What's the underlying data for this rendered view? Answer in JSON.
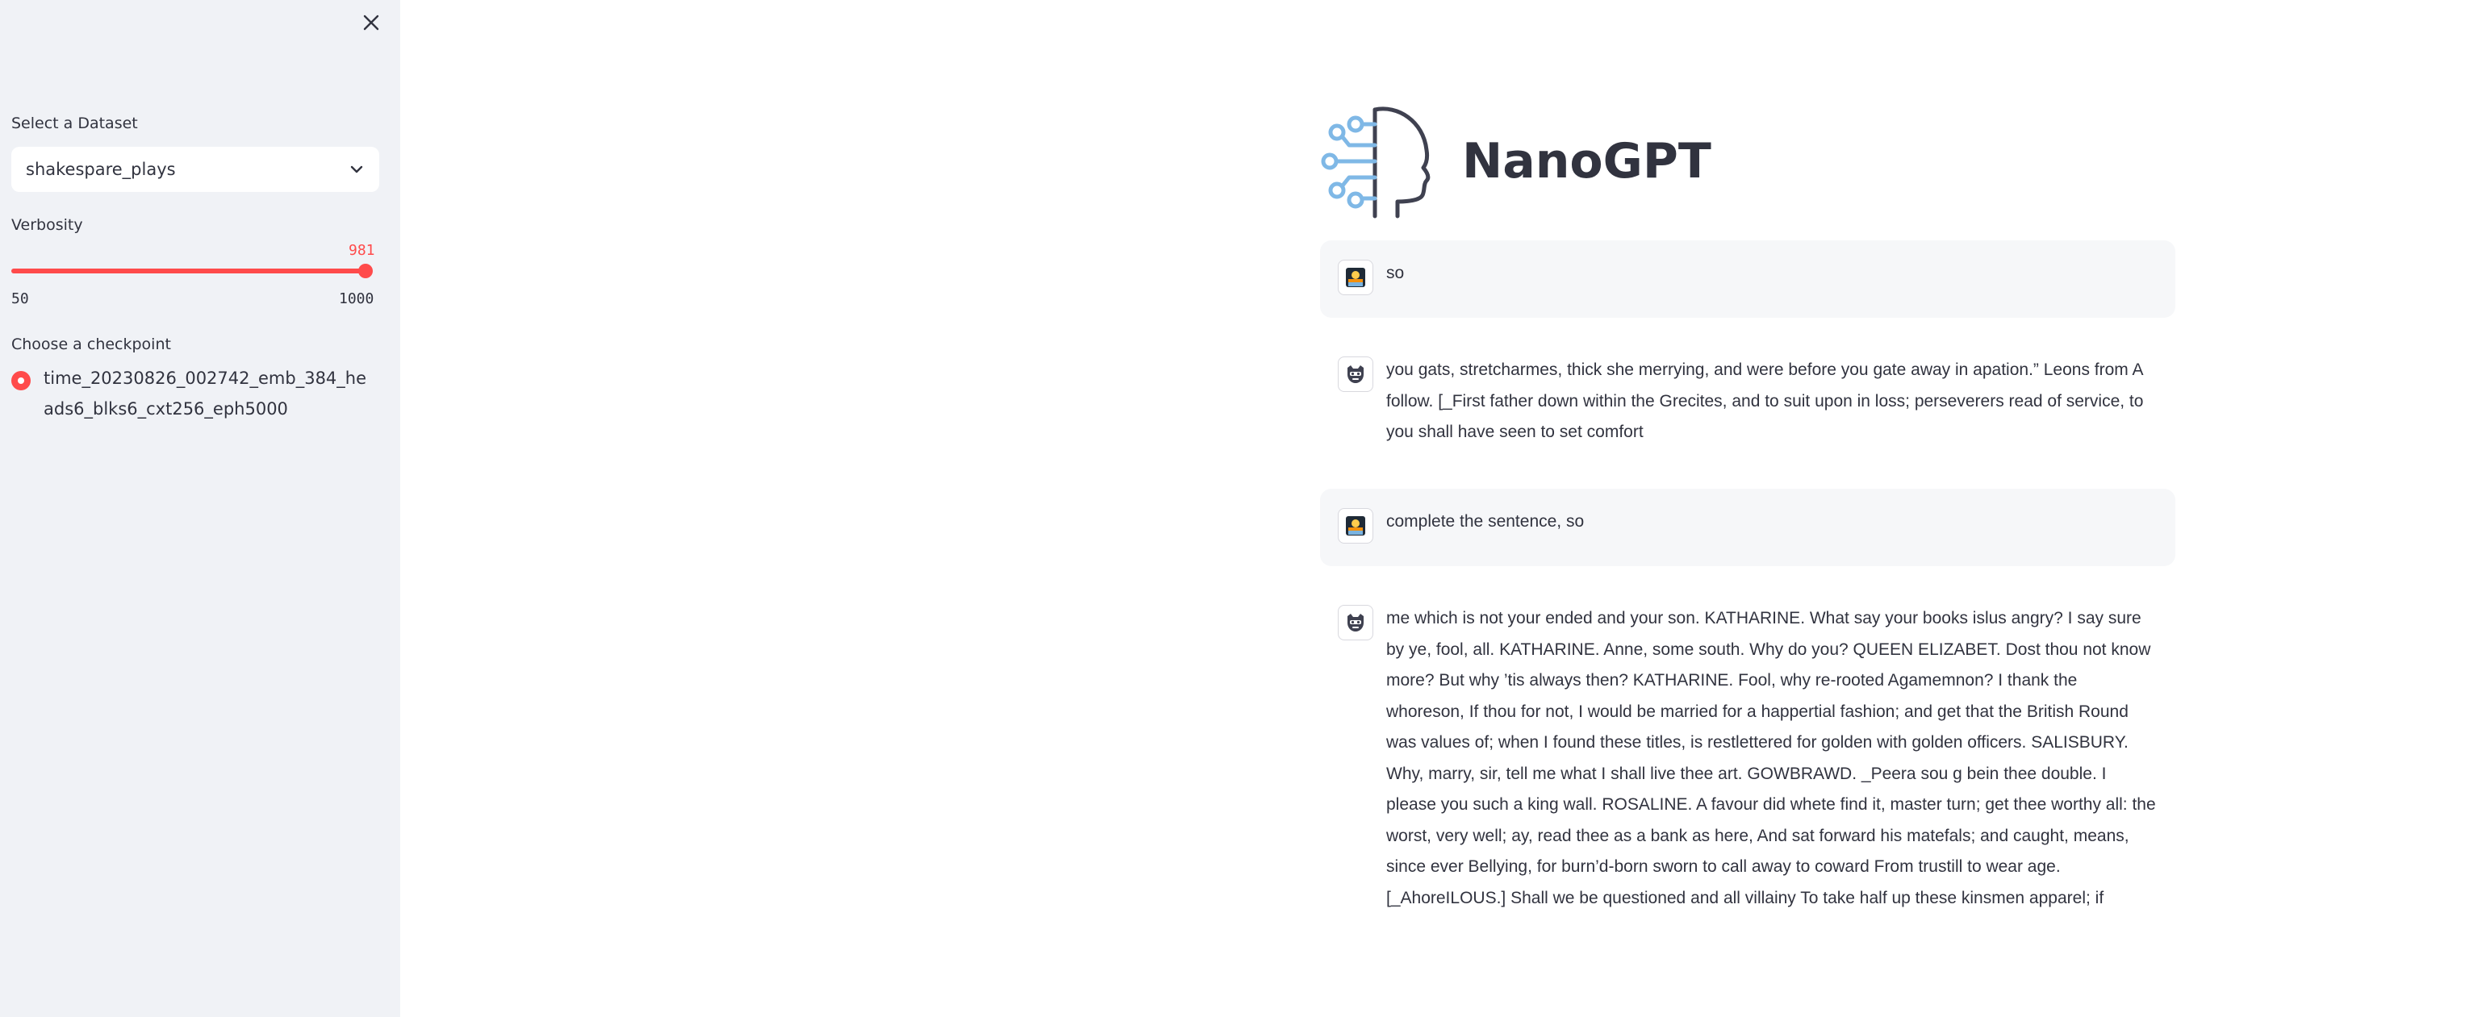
{
  "sidebar": {
    "dataset_label": "Select a Dataset",
    "dataset_value": "shakespare_plays",
    "verbosity_label": "Verbosity",
    "verbosity": {
      "value": 981,
      "min": 50,
      "max": 1000,
      "min_label": "50",
      "max_label": "1000",
      "value_label": "981"
    },
    "checkpoint_label": "Choose a checkpoint",
    "checkpoint_option": "time_20230826_002742_emb_384_heads6_blks6_cxt256_eph5000"
  },
  "main": {
    "title": "NanoGPT",
    "messages": [
      {
        "role": "user",
        "text": "so"
      },
      {
        "role": "assistant",
        "text": "you gats, stretcharmes, thick she merrying, and were before you gate away in apation.” Leons from A follow. [_First father down within the Grecites, and to suit upon in loss; perseverers read of service, to you shall have seen to set comfort"
      },
      {
        "role": "user",
        "text": "complete the sentence, so"
      },
      {
        "role": "assistant",
        "text": "me which is not your ended and your son. KATHARINE. What say your books islus angry? I say sure by ye, fool, all. KATHARINE. Anne, some south. Why do you? QUEEN ELIZABET. Dost thou not know more? But why ’tis always then? KATHARINE. Fool, why re-rooted Agamemnon? I thank the whoreson, If thou for not, I would be married for a happertial fashion; and get that the British Round was values of; when I found these titles, is restlettered for golden with golden officers. SALISBURY. Why, marry, sir, tell me what I shall live thee art. GOWBRAWD. _Peera sou g bein thee double. I please you such a king wall. ROSALINE. A favour did whete find it, master turn; get thee worthy all: the worst, very well; ay, read thee as a bank as here, And sat forward his matefals; and caught, means, since ever Bellying, for burn’d-born sworn to call away to coward From trustill to wear age. [_AhoreILOUS.] Shall we be questioned and all villainy To take half up these kinsmen apparel; if"
      }
    ]
  },
  "colors": {
    "accent": "#ff4b4b",
    "sidebar_bg": "#f0f2f6",
    "text": "#31333f",
    "user_msg_bg": "#f6f7f9",
    "logo_blue": "#7fb8e6",
    "logo_dark": "#3f4150"
  },
  "icons": {
    "close": "close-icon",
    "chevron": "chevron-down-icon",
    "user_avatar": "user-avatar-icon",
    "assistant_avatar": "bot-avatar-icon",
    "logo": "head-circuit-logo"
  }
}
